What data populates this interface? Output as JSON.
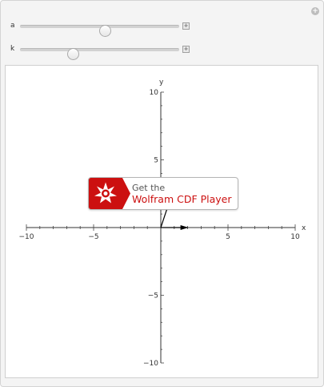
{
  "controls": {
    "sliders": [
      {
        "label": "a",
        "value_fraction": 0.54
      },
      {
        "label": "k",
        "value_fraction": 0.32
      }
    ],
    "add_icon": "plus-circle-icon",
    "step_icon": "plus-box-icon"
  },
  "plot": {
    "x_axis_label": "x",
    "y_axis_label": "y",
    "x_ticks": [
      "−10",
      "−5",
      "5",
      "10"
    ],
    "y_ticks": [
      "10",
      "5",
      "−5",
      "−10"
    ],
    "x_range": [
      -10,
      10
    ],
    "y_range": [
      -10,
      10
    ],
    "vectors": [
      {
        "name": "arrow",
        "x": 2.0,
        "y": 0.0,
        "color": "#000000"
      },
      {
        "name": "line",
        "x": 0.5,
        "y": 1.5,
        "color": "#000000"
      }
    ]
  },
  "badge": {
    "line1": "Get the",
    "line2": "Wolfram CDF Player",
    "accent": "#cc1010"
  }
}
